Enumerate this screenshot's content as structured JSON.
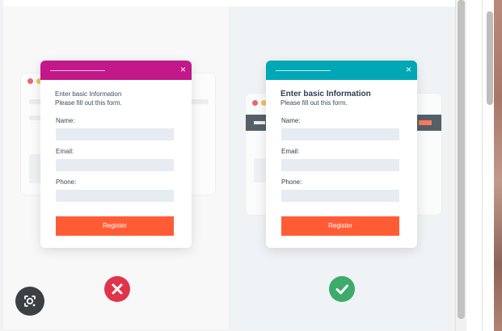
{
  "comparison": {
    "bad_example": {
      "header_color": "#c2188a",
      "close_glyph": "×",
      "title": "Enter basic Information",
      "subtitle": "Please fill out this form.",
      "fields": [
        {
          "label": "Name:"
        },
        {
          "label": "Email:"
        },
        {
          "label": "Phone:"
        }
      ],
      "button_label": "Register",
      "verdict_icon": "cross-icon",
      "verdict_color": "#e0344b"
    },
    "good_example": {
      "header_color": "#00a7b5",
      "close_glyph": "×",
      "title": "Enter basic Information",
      "subtitle": "Please fill out this form.",
      "fields": [
        {
          "label": "Name:"
        },
        {
          "label": "Email:"
        },
        {
          "label": "Phone:"
        }
      ],
      "button_label": "Register",
      "verdict_icon": "check-icon",
      "verdict_color": "#3dab6b"
    }
  },
  "overlay": {
    "lens_icon": "visual-search-icon"
  },
  "colors": {
    "button": "#ff5c35",
    "input": "#e6ecf1",
    "text": "#3d4a5c"
  }
}
